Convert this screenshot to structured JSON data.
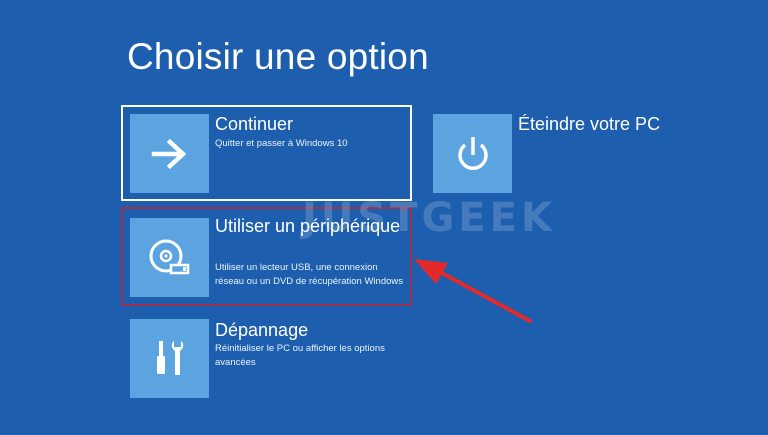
{
  "screen": {
    "title": "Choisir une option"
  },
  "options": {
    "continue": {
      "label": "Continuer",
      "description": "Quitter et passer à Windows 10",
      "icon": "arrow-right-icon"
    },
    "shutdown": {
      "label": "Éteindre votre PC",
      "icon": "power-icon"
    },
    "use_device": {
      "label": "Utiliser un périphérique",
      "description": "Utiliser un lecteur USB, une connexion réseau ou un DVD de récupération Windows",
      "icon": "disc-usb-icon"
    },
    "troubleshoot": {
      "label": "Dépannage",
      "description": "Réinitialiser le PC ou afficher les options avancées",
      "icon": "tools-icon"
    }
  },
  "overlay": {
    "watermark": "JUSTGEEK",
    "annotation_arrow_color": "#e32a2a",
    "highlight_border_color": "#9a3450"
  },
  "colors": {
    "background": "#1d5fae",
    "tile": "#5ca4e0"
  }
}
